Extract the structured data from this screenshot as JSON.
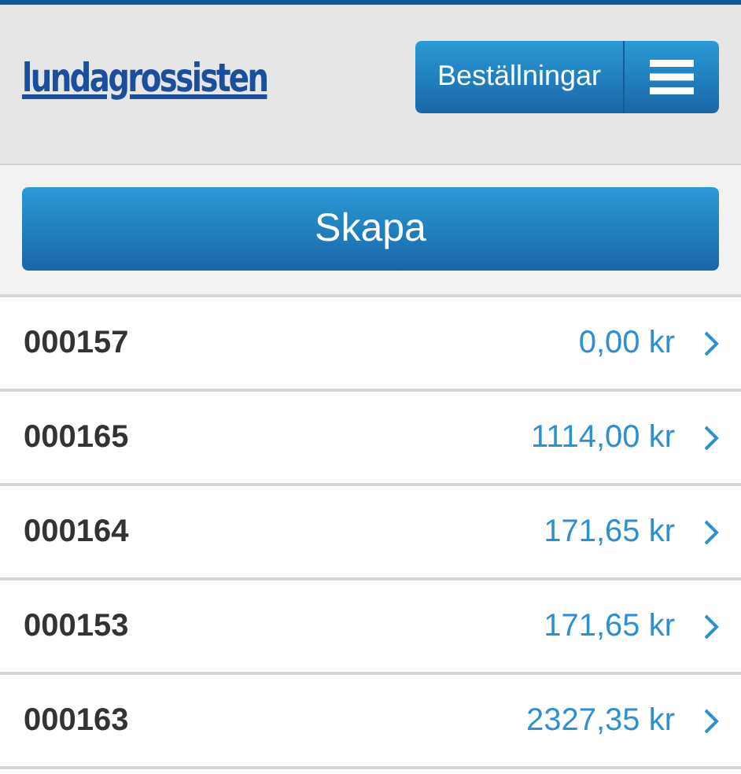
{
  "header": {
    "logo": "lundagrossisten",
    "nav_button": "Beställningar"
  },
  "create_button": "Skapa",
  "orders": [
    {
      "number": "000157",
      "amount": "0,00 kr"
    },
    {
      "number": "000165",
      "amount": "1114,00 kr"
    },
    {
      "number": "000164",
      "amount": "171,65 kr"
    },
    {
      "number": "000153",
      "amount": "171,65 kr"
    },
    {
      "number": "000163",
      "amount": "2327,35 kr"
    }
  ]
}
